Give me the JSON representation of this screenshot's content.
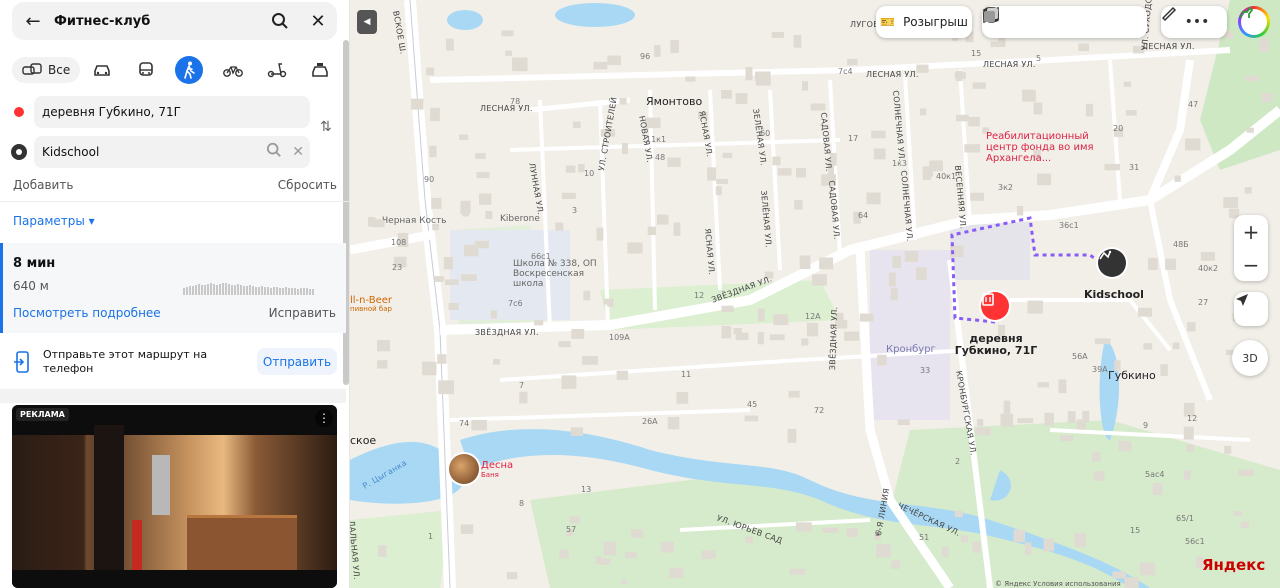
{
  "search": {
    "query": "Фитнес-клуб"
  },
  "modes": {
    "all_label": "Все"
  },
  "route": {
    "from": "деревня Губкино, 71Г",
    "to": "Kidschool",
    "add_label": "Добавить",
    "reset_label": "Сбросить",
    "params_label": "Параметры ▾",
    "time": "8 мин",
    "distance": "640 м",
    "details_link": "Посмотреть подробнее",
    "fix_link": "Исправить"
  },
  "send": {
    "text": "Отправьте этот маршрут на телефон",
    "button": "Отправить"
  },
  "ad": {
    "label": "РЕКЛАМА"
  },
  "map": {
    "raffle_label": "Розыгрыш",
    "zoom_in": "+",
    "zoom_out": "−",
    "btn_3d": "3D",
    "logo": "Яндекс",
    "copyright": "© Яндекс Условия использования",
    "places": {
      "yamontovo": "Ямонтово",
      "gubkino": "Губкино",
      "kronburg": "Кронбург",
      "skoe": "ское",
      "start_label": "деревня Губкино, 71Г",
      "end_label": "Kidschool",
      "rehab": "Реабилитационный центр фонда во имя Архангела...",
      "kiberone": "Kiberone",
      "chernaya_kost": "Черная Кость",
      "school": "Школа № 338, ОП Воскресенская школа",
      "desna": "Десна",
      "desna_sub": "Баня",
      "beer": "ll-n-Beer",
      "beer_sub": "пивной бар"
    },
    "streets": {
      "zvezdnaya1": "ЗВЁЗДНАЯ УЛ.",
      "zvezdnaya2": "ЗВЁЗДНАЯ УЛ.",
      "zvezdnaya3": "ЗВЁЗДНАЯ УЛ.",
      "lesnaya1": "ЛЕСНАЯ УЛ.",
      "lesnaya2": "ЛЕСНАЯ УЛ.",
      "lesnaya3": "ЛЕСНАЯ УЛ.",
      "lesnaya4": "ЛЕСНАЯ УЛ.",
      "stroiteley": "УЛ. СТРОИТЕЛЕЙ",
      "lunnaya": "ЛУННАЯ УЛ.",
      "novaya": "НОВАЯ УЛ.",
      "yasnaya1": "ЯСНАЯ УЛ.",
      "yasnaya2": "ЯСНАЯ УЛ.",
      "zelenaya1": "ЗЕЛЁНАЯ УЛ.",
      "zelenaya2": "ЗЕЛЁНАЯ УЛ.",
      "sadovaya1": "САДОВАЯ УЛ.",
      "sadovaya2": "САДОВАЯ УЛ.",
      "solnechnaya1": "СОЛНЕЧНАЯ УЛ.",
      "solnechnaya2": "СОЛНЕЧНАЯ УЛ.",
      "vesennyaya": "ВЕСЕННЯЯ УЛ.",
      "sukhodolye": "УЛ. СУХОДОЛЬЕ",
      "kronburgskaya": "КРОНБУРГСКАЯ УЛ.",
      "chechyorskaya": "ЧЕЧЁРСКАЯ УЛ.",
      "yuryev": "УЛ. ЮРЬЕВ САД",
      "tsyganka": "Р. Цыганка",
      "lugovaya": "ЛУГОВ",
      "linia": "6-Я ЛИНИЯ",
      "sosh": "ВСКОЕ Ш.",
      "dalnaya": "ДАЛЬНАЯ УЛ."
    },
    "numbers": [
      "48",
      "48Б",
      "40к1",
      "40к2",
      "12",
      "12",
      "11",
      "15",
      "9",
      "20",
      "3",
      "39А",
      "36с1",
      "26А",
      "74",
      "12А",
      "109А",
      "108",
      "96",
      "60",
      "65/1",
      "17",
      "8",
      "7",
      "64",
      "5",
      "1",
      "2",
      "3",
      "47",
      "57",
      "56с1",
      "7с6",
      "7с4",
      "66с1",
      "23",
      "27",
      "33",
      "31",
      "56А",
      "51",
      "90",
      "45",
      "72",
      "5ас4",
      "78",
      "1к3",
      "3к2",
      "11к1",
      "13",
      "15",
      "10"
    ]
  }
}
